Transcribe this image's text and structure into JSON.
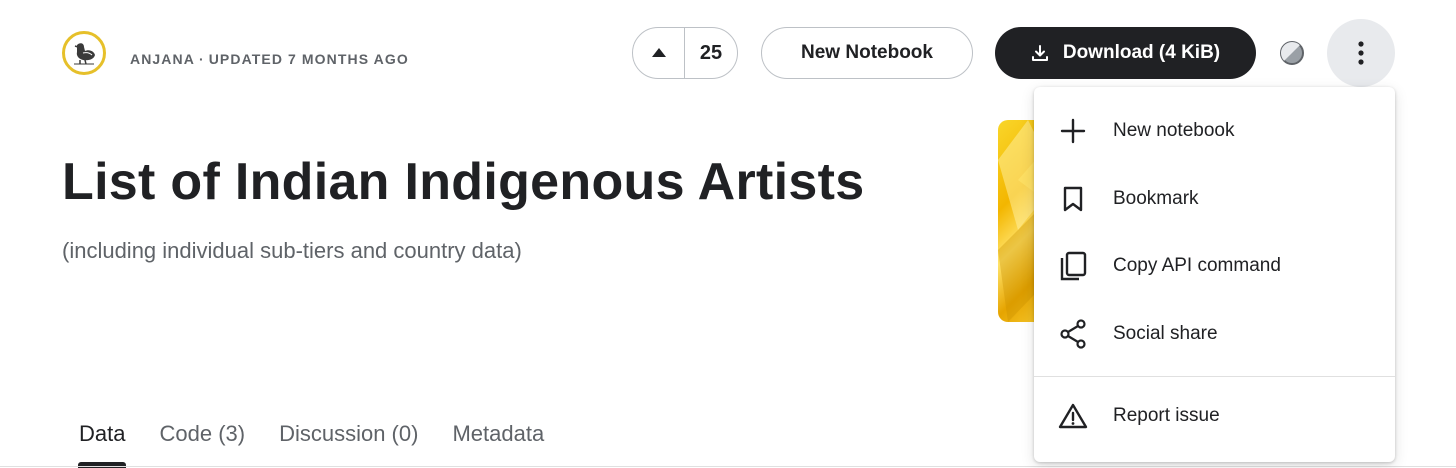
{
  "header": {
    "owner": "ANJANA",
    "separator": "·",
    "updated": "UPDATED 7 MONTHS AGO",
    "vote_count": "25",
    "new_notebook_label": "New Notebook",
    "download_label": "Download (4 KiB)"
  },
  "main": {
    "title": "List of Indian Indigenous Artists",
    "subtitle": "(including individual sub-tiers and country data)"
  },
  "tabs": [
    {
      "label": "Data",
      "active": true
    },
    {
      "label": "Code (3)",
      "active": false
    },
    {
      "label": "Discussion (0)",
      "active": false
    },
    {
      "label": "Metadata",
      "active": false
    }
  ],
  "menu": {
    "items": [
      {
        "label": "New notebook",
        "icon": "plus-icon"
      },
      {
        "label": "Bookmark",
        "icon": "bookmark-icon"
      },
      {
        "label": "Copy API command",
        "icon": "copy-icon"
      },
      {
        "label": "Social share",
        "icon": "share-icon"
      },
      {
        "label": "Report issue",
        "icon": "warning-icon"
      }
    ]
  },
  "colors": {
    "accent_dark": "#202124",
    "avatar_ring": "#e6c02a",
    "muted_text": "#5f6368"
  }
}
